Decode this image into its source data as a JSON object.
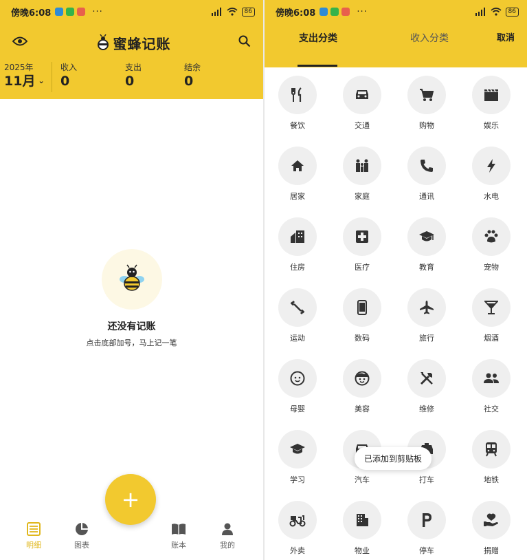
{
  "status": {
    "time": "傍晚6:08",
    "battery": "86"
  },
  "ledger": {
    "app_title": "蜜蜂记账",
    "year": "2025年",
    "month": "11月",
    "income_label": "收入",
    "income_value": "0",
    "expense_label": "支出",
    "expense_value": "0",
    "balance_label": "结余",
    "balance_value": "0",
    "empty_title": "还没有记账",
    "empty_subtitle": "点击底部加号，马上记一笔",
    "fab_label": "+",
    "nav": [
      {
        "label": "明细",
        "icon": "list-icon",
        "active": true
      },
      {
        "label": "图表",
        "icon": "pie-chart-icon",
        "active": false
      },
      {
        "label": "账本",
        "icon": "book-icon",
        "active": false
      },
      {
        "label": "我的",
        "icon": "person-icon",
        "active": false
      }
    ]
  },
  "category_picker": {
    "tab_expense": "支出分类",
    "tab_income": "收入分类",
    "cancel": "取消",
    "toast": "已添加到剪贴板",
    "categories": [
      {
        "label": "餐饮",
        "icon": "utensils-icon"
      },
      {
        "label": "交通",
        "icon": "car-icon"
      },
      {
        "label": "购物",
        "icon": "cart-icon"
      },
      {
        "label": "娱乐",
        "icon": "clapperboard-icon"
      },
      {
        "label": "居家",
        "icon": "home-icon"
      },
      {
        "label": "家庭",
        "icon": "family-icon"
      },
      {
        "label": "通讯",
        "icon": "phone-icon"
      },
      {
        "label": "水电",
        "icon": "bolt-icon"
      },
      {
        "label": "住房",
        "icon": "building-home-icon"
      },
      {
        "label": "医疗",
        "icon": "medical-icon"
      },
      {
        "label": "教育",
        "icon": "graduation-icon"
      },
      {
        "label": "宠物",
        "icon": "paw-icon"
      },
      {
        "label": "运动",
        "icon": "dumbbell-icon"
      },
      {
        "label": "数码",
        "icon": "smartphone-icon"
      },
      {
        "label": "旅行",
        "icon": "airplane-icon"
      },
      {
        "label": "烟酒",
        "icon": "cocktail-icon"
      },
      {
        "label": "母婴",
        "icon": "baby-icon"
      },
      {
        "label": "美容",
        "icon": "face-icon"
      },
      {
        "label": "维修",
        "icon": "tools-icon"
      },
      {
        "label": "社交",
        "icon": "people-icon"
      },
      {
        "label": "学习",
        "icon": "school-icon"
      },
      {
        "label": "汽车",
        "icon": "car-front-icon"
      },
      {
        "label": "打车",
        "icon": "taxi-icon"
      },
      {
        "label": "地铁",
        "icon": "subway-icon"
      },
      {
        "label": "外卖",
        "icon": "delivery-icon"
      },
      {
        "label": "物业",
        "icon": "apartment-icon"
      },
      {
        "label": "停车",
        "icon": "parking-icon"
      },
      {
        "label": "捐赠",
        "icon": "donation-icon"
      }
    ]
  },
  "colors": {
    "brand_yellow": "#F2C92F",
    "active_nav": "#E0B71C",
    "icon_circle": "#EFEFEF"
  }
}
